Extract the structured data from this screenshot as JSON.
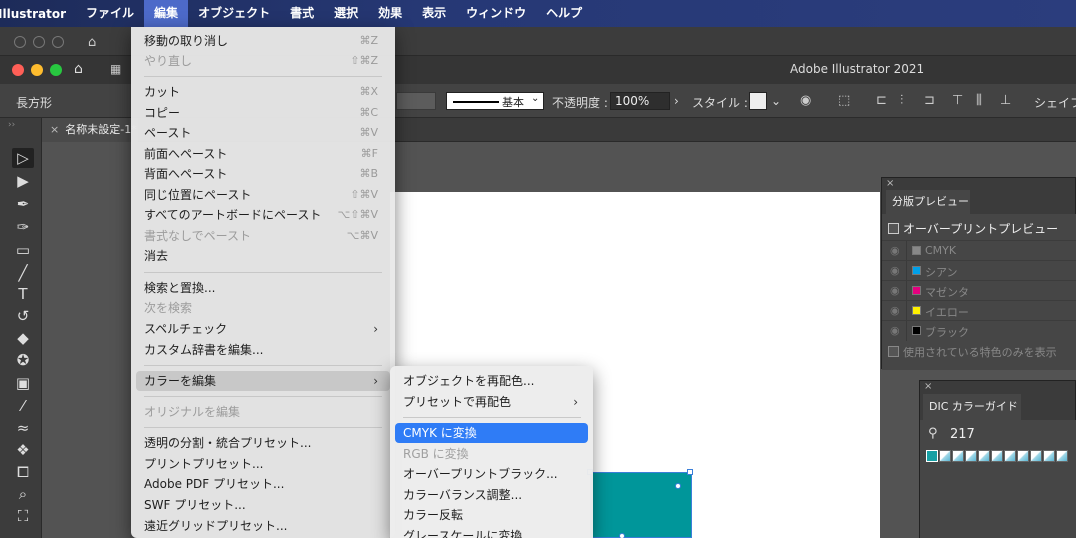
{
  "menubar": {
    "app": "Illustrator",
    "items": [
      "ファイル",
      "編集",
      "オブジェクト",
      "書式",
      "選択",
      "効果",
      "表示",
      "ウィンドウ",
      "ヘルプ"
    ],
    "active_index": 1
  },
  "titlebar": {
    "title": "Adobe Illustrator 2021"
  },
  "controlbar": {
    "shape_label": "長方形",
    "stroke_profile": "基本",
    "opacity_label": "不透明度 :",
    "opacity_value": "100%",
    "style_label": "スタイル :",
    "shape_label_right": "シェイフ"
  },
  "document_tab": {
    "name": "名称未設定-1*"
  },
  "edit_menu": {
    "items": [
      {
        "label": "移動の取り消し",
        "shortcut": "⌘Z",
        "disabled": false
      },
      {
        "label": "やり直し",
        "shortcut": "⇧⌘Z",
        "disabled": true
      },
      {
        "label": "カット",
        "shortcut": "⌘X",
        "disabled": false
      },
      {
        "label": "コピー",
        "shortcut": "⌘C",
        "disabled": false
      },
      {
        "label": "ペースト",
        "shortcut": "⌘V",
        "disabled": false
      },
      {
        "label": "前面へペースト",
        "shortcut": "⌘F",
        "disabled": false
      },
      {
        "label": "背面へペースト",
        "shortcut": "⌘B",
        "disabled": false
      },
      {
        "label": "同じ位置にペースト",
        "shortcut": "⇧⌘V",
        "disabled": false
      },
      {
        "label": "すべてのアートボードにペースト",
        "shortcut": "⌥⇧⌘V",
        "disabled": false
      },
      {
        "label": "書式なしでペースト",
        "shortcut": "⌥⌘V",
        "disabled": true
      },
      {
        "label": "消去",
        "shortcut": "",
        "disabled": false
      },
      {
        "label": "検索と置換...",
        "shortcut": "",
        "disabled": false
      },
      {
        "label": "次を検索",
        "shortcut": "",
        "disabled": true
      },
      {
        "label": "スペルチェック",
        "shortcut": "",
        "disabled": false,
        "submenu": true
      },
      {
        "label": "カスタム辞書を編集...",
        "shortcut": "",
        "disabled": false
      },
      {
        "label": "カラーを編集",
        "shortcut": "",
        "disabled": false,
        "submenu": true,
        "highlighted": true
      },
      {
        "label": "オリジナルを編集",
        "shortcut": "",
        "disabled": true
      },
      {
        "label": "透明の分割・統合プリセット...",
        "shortcut": "",
        "disabled": false
      },
      {
        "label": "プリントプリセット...",
        "shortcut": "",
        "disabled": false
      },
      {
        "label": "Adobe PDF プリセット...",
        "shortcut": "",
        "disabled": false
      },
      {
        "label": "SWF プリセット...",
        "shortcut": "",
        "disabled": false
      },
      {
        "label": "遠近グリッドプリセット...",
        "shortcut": "",
        "disabled": false
      }
    ]
  },
  "color_submenu": {
    "items": [
      {
        "label": "オブジェクトを再配色...",
        "disabled": false
      },
      {
        "label": "プリセットで再配色",
        "disabled": false,
        "submenu": true
      },
      {
        "label": "CMYK に変換",
        "disabled": false,
        "selected": true
      },
      {
        "label": "RGB に変換",
        "disabled": true
      },
      {
        "label": "オーバープリントブラック...",
        "disabled": false
      },
      {
        "label": "カラーバランス調整...",
        "disabled": false
      },
      {
        "label": "カラー反転",
        "disabled": false
      },
      {
        "label": "グレースケールに変換",
        "disabled": false
      }
    ]
  },
  "separations_panel": {
    "title": "分版プレビュー",
    "overprint_label": "オーバープリントプレビュー",
    "rows": [
      {
        "name": "CMYK",
        "color": "#888888"
      },
      {
        "name": "シアン",
        "color": "#00a0e9"
      },
      {
        "name": "マゼンタ",
        "color": "#e4007f"
      },
      {
        "name": "イエロー",
        "color": "#fff100"
      },
      {
        "name": "ブラック",
        "color": "#000000"
      }
    ],
    "spot_only_label": "使用されている特色のみを表示"
  },
  "dic_panel": {
    "title": "DIC カラーガイド",
    "search_value": "217"
  },
  "colors": {
    "menu_highlight": "#2f7cf6",
    "object_fill": "#00969a"
  }
}
